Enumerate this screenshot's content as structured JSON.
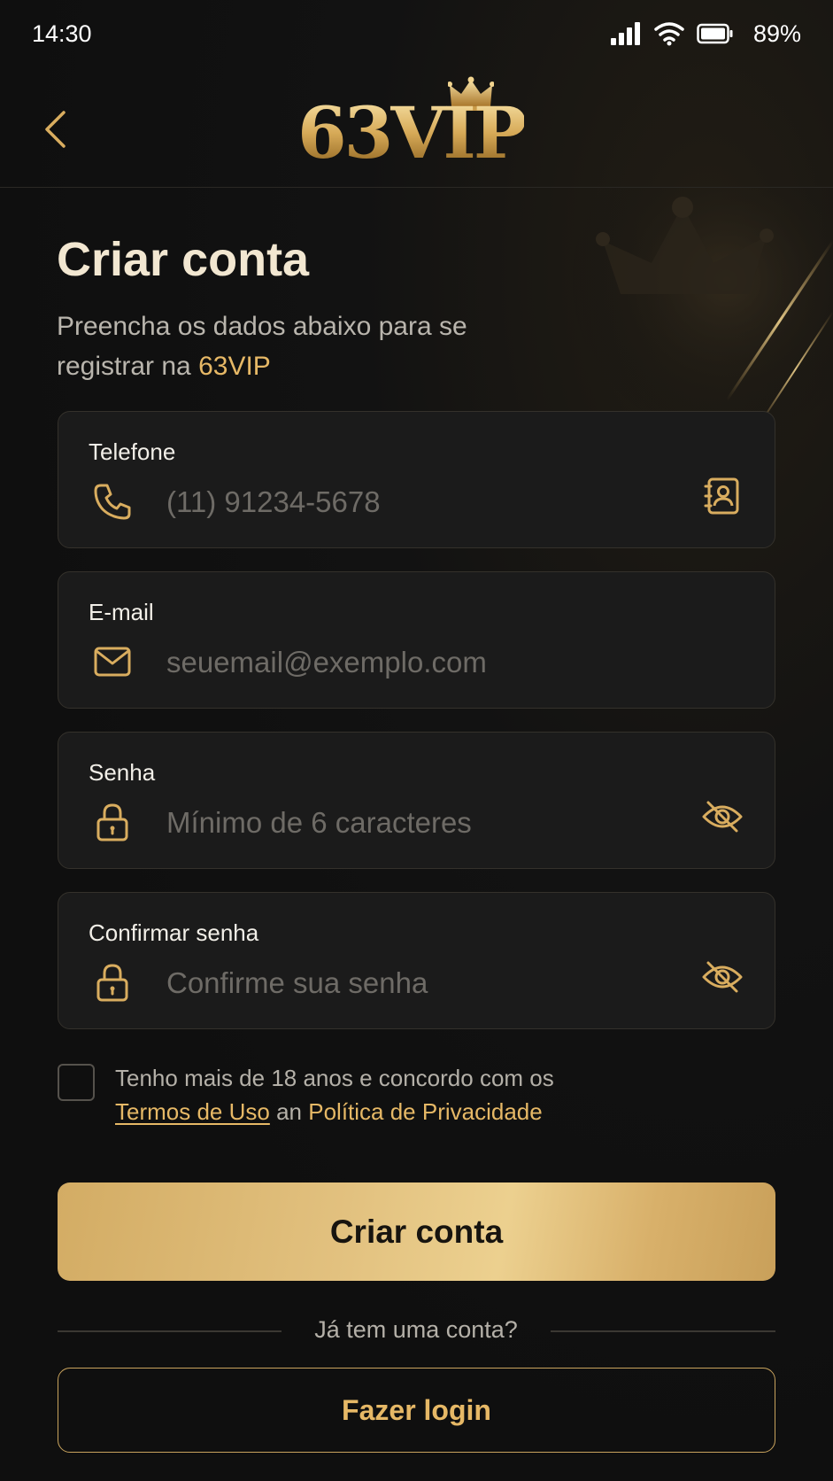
{
  "status_bar": {
    "time": "14:30",
    "battery": "89%"
  },
  "header": {
    "logo_text": "63VIP"
  },
  "title": "Criar conta",
  "subtitle": {
    "text": "Preencha os dados abaixo para se registrar na ",
    "brand": "63VIP"
  },
  "fields": {
    "phone": {
      "label": "Telefone",
      "placeholder": "(11) 91234-5678",
      "icon": "phone-icon",
      "action_icon": "contacts-icon"
    },
    "email": {
      "label": "E-mail",
      "placeholder": "seuemail@exemplo.com",
      "icon": "mail-icon"
    },
    "password": {
      "label": "Senha",
      "placeholder": "Mínimo de 6 caracteres",
      "icon": "lock-icon",
      "action_icon": "eye-off-icon"
    },
    "confirm_password": {
      "label": "Confirmar senha",
      "placeholder": "Confirme sua senha",
      "icon": "lock-icon",
      "action_icon": "eye-off-icon"
    }
  },
  "terms": {
    "text": "Tenho mais de 18 anos e concordo com os",
    "terms_link": "Termos de Uso",
    "connector": "an",
    "privacy_link": "Política de Privacidade"
  },
  "primary_button": "Criar conta",
  "divider_text": "Já tem uma conta?",
  "secondary_button": "Fazer login",
  "colors": {
    "accent": "#e6b866",
    "background": "#0f0f0f",
    "field_bg": "#1b1b1b"
  }
}
